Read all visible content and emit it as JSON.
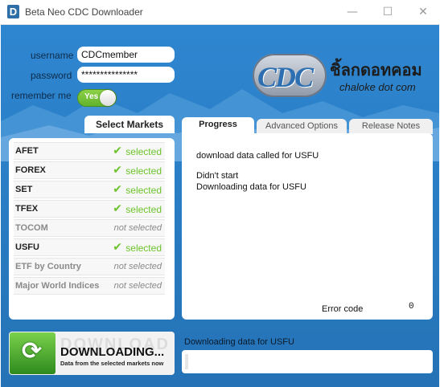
{
  "window": {
    "title": "Beta Neo CDC Downloader",
    "app_icon": "D",
    "minimize_glyph": "—",
    "maximize_glyph": "☐",
    "close_glyph": "✕"
  },
  "login": {
    "username_label": "username",
    "username_value": "CDCmember",
    "password_label": "password",
    "password_value": "***************",
    "remember_label": "remember me",
    "remember_toggle": "Yes"
  },
  "logo": {
    "cdc_text": "CDC",
    "thai_text": "ชิ้ลกดอทคอม",
    "dot_text": "chaloke dot com"
  },
  "markets": {
    "header": "Select Markets",
    "items": [
      {
        "name": "AFET",
        "status": "selected",
        "selected": true
      },
      {
        "name": "FOREX",
        "status": "selected",
        "selected": true
      },
      {
        "name": "SET",
        "status": "selected",
        "selected": true
      },
      {
        "name": "TFEX",
        "status": "selected",
        "selected": true
      },
      {
        "name": "TOCOM",
        "status": "not selected",
        "selected": false
      },
      {
        "name": "USFU",
        "status": "selected",
        "selected": true
      },
      {
        "name": "ETF by Country",
        "status": "not selected",
        "selected": false
      },
      {
        "name": "Major World Indices",
        "status": "not selected",
        "selected": false
      }
    ]
  },
  "tabs": {
    "progress": "Progress",
    "advanced": "Advanced Options",
    "release": "Release Notes"
  },
  "progress_log": {
    "line1": "download data called for USFU",
    "line2": "Didn't start",
    "line3": "Downloading data for USFU",
    "error_label": "Error code",
    "error_value": "0"
  },
  "download_button": {
    "ghost_text": "DOWNLOAD",
    "title": "DOWNLOADING...",
    "subtitle": "Data from the selected markets now",
    "icon": "refresh-icon"
  },
  "status": {
    "text": "Downloading data for USFU",
    "progress_fraction": 0.01
  },
  "colors": {
    "background_blue": "#2a7fc6",
    "selected_green": "#6cc32a",
    "toggle_green": "#5fb12a"
  }
}
